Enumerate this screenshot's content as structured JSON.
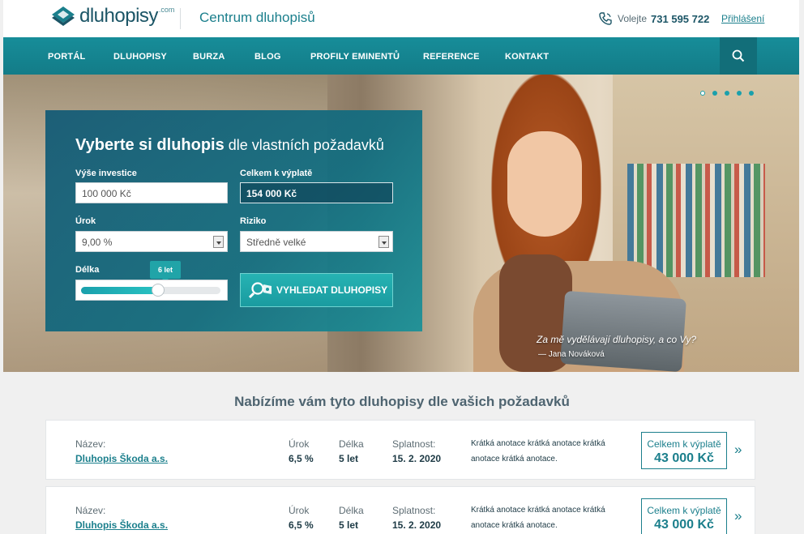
{
  "header": {
    "logo_text": "dluhopisy",
    "logo_suffix": ".com",
    "tagline": "Centrum dluhopisů",
    "phone_label": "Volejte",
    "phone_number": "731 595 722",
    "login_label": "Přihlášení"
  },
  "nav": {
    "items": [
      {
        "label": "PORTÁL"
      },
      {
        "label": "DLUHOPISY"
      },
      {
        "label": "BURZA"
      },
      {
        "label": "BLOG"
      },
      {
        "label": "PROFILY EMINENTŮ"
      },
      {
        "label": "REFERENCE"
      },
      {
        "label": "KONTAKT"
      }
    ],
    "search_icon": "search-icon"
  },
  "hero": {
    "quote": "Za mě vydělávají dluhopisy, a co Vy?",
    "quote_author": "— Jana Nováková",
    "slider_dots": 5,
    "active_dot": 1
  },
  "form": {
    "title_bold": "Vyberte si dluhopis",
    "title_rest": " dle vlastních požadavků",
    "investment_label": "Výše investice",
    "investment_value": "100 000 Kč",
    "total_label": "Celkem k výplatě",
    "total_value": "154 000 Kč",
    "rate_label": "Úrok",
    "rate_value": "9,00 %",
    "risk_label": "Riziko",
    "risk_value": "Středně velké",
    "length_label": "Délka",
    "length_tooltip": "6 let",
    "length_fraction": 0.55,
    "search_label": "VYHLEDAT DLUHOPISY"
  },
  "results": {
    "title": "Nabízíme vám tyto dluhopisy dle vašich požadavků",
    "labels": {
      "name": "Název:",
      "rate": "Úrok",
      "length": "Délka",
      "maturity": "Splatnost:",
      "total": "Celkem k výplatě"
    },
    "rows": [
      {
        "name": "Dluhopis Škoda a.s.",
        "rate": "6,5 %",
        "length": "5 let",
        "maturity": "15. 2. 2020",
        "annotation": "Krátká anotace krátká anotace krátká anotace krátká anotace.",
        "total": "43 000 Kč",
        "arrow": "»"
      },
      {
        "name": "Dluhopis Škoda a.s.",
        "rate": "6,5 %",
        "length": "5 let",
        "maturity": "15. 2. 2020",
        "annotation": "Krátká anotace krátká anotace krátká anotace krátká anotace.",
        "total": "43 000 Kč",
        "arrow": "»"
      }
    ]
  },
  "colors": {
    "brand": "#1b7f8c",
    "nav_bg": "#178d99",
    "dark_text": "#1d4a5a",
    "accent_button": "#26b3b3"
  }
}
